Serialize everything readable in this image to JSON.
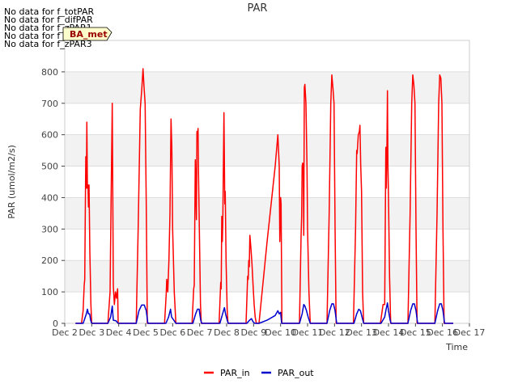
{
  "chart_data": {
    "type": "line",
    "title": "PAR",
    "xlabel": "Time",
    "ylabel": "PAR (umol/m2/s)",
    "ylim": [
      0,
      900
    ],
    "xlim": [
      2,
      17
    ],
    "yticks": [
      0,
      100,
      200,
      300,
      400,
      500,
      600,
      700,
      800
    ],
    "xticks": [
      {
        "x": 2,
        "label": "Dec 2"
      },
      {
        "x": 3,
        "label": "Dec 3"
      },
      {
        "x": 4,
        "label": "Dec 4"
      },
      {
        "x": 5,
        "label": "Dec 5"
      },
      {
        "x": 6,
        "label": "Dec 6"
      },
      {
        "x": 7,
        "label": "Dec 7"
      },
      {
        "x": 8,
        "label": "Dec 8"
      },
      {
        "x": 9,
        "label": "Dec 9"
      },
      {
        "x": 10,
        "label": "Dec 10"
      },
      {
        "x": 11,
        "label": "Dec 11"
      },
      {
        "x": 12,
        "label": "Dec 12"
      },
      {
        "x": 13,
        "label": "Dec 13"
      },
      {
        "x": 14,
        "label": "Dec 14"
      },
      {
        "x": 15,
        "label": "Dec 15"
      },
      {
        "x": 16,
        "label": "Dec 16"
      },
      {
        "x": 17,
        "label": "Dec 17"
      }
    ],
    "no_data_notes": [
      "No data for f_totPAR",
      "No data for f_difPAR",
      "No data for f_zPAR1",
      "No data for f_zPAR2",
      "No data for f_zPAR3"
    ],
    "tooltip": "BA_met",
    "grid": true,
    "legend_position": "bottom-center",
    "series": [
      {
        "name": "PAR_in",
        "color": "#ff0000",
        "points": [
          [
            2.4,
            0
          ],
          [
            2.62,
            0
          ],
          [
            2.68,
            40
          ],
          [
            2.72,
            120
          ],
          [
            2.74,
            140
          ],
          [
            2.76,
            330
          ],
          [
            2.78,
            530
          ],
          [
            2.8,
            430
          ],
          [
            2.82,
            640
          ],
          [
            2.84,
            430
          ],
          [
            2.86,
            440
          ],
          [
            2.88,
            370
          ],
          [
            2.9,
            440
          ],
          [
            2.93,
            230
          ],
          [
            2.97,
            60
          ],
          [
            3.0,
            0
          ],
          [
            3.6,
            0
          ],
          [
            3.68,
            100
          ],
          [
            3.72,
            400
          ],
          [
            3.76,
            700
          ],
          [
            3.8,
            120
          ],
          [
            3.84,
            60
          ],
          [
            3.88,
            100
          ],
          [
            3.92,
            80
          ],
          [
            3.96,
            110
          ],
          [
            3.98,
            0
          ],
          [
            4.65,
            0
          ],
          [
            4.72,
            300
          ],
          [
            4.8,
            680
          ],
          [
            4.86,
            750
          ],
          [
            4.9,
            810
          ],
          [
            4.94,
            750
          ],
          [
            4.98,
            700
          ],
          [
            5.02,
            380
          ],
          [
            5.06,
            0
          ],
          [
            5.7,
            0
          ],
          [
            5.76,
            90
          ],
          [
            5.78,
            140
          ],
          [
            5.82,
            100
          ],
          [
            5.86,
            200
          ],
          [
            5.9,
            350
          ],
          [
            5.94,
            650
          ],
          [
            5.97,
            560
          ],
          [
            6.0,
            300
          ],
          [
            6.06,
            100
          ],
          [
            6.12,
            0
          ],
          [
            6.72,
            0
          ],
          [
            6.78,
            110
          ],
          [
            6.8,
            120
          ],
          [
            6.84,
            520
          ],
          [
            6.86,
            420
          ],
          [
            6.88,
            330
          ],
          [
            6.9,
            610
          ],
          [
            6.92,
            600
          ],
          [
            6.94,
            620
          ],
          [
            6.96,
            470
          ],
          [
            6.99,
            300
          ],
          [
            7.03,
            60
          ],
          [
            7.06,
            0
          ],
          [
            7.72,
            0
          ],
          [
            7.78,
            130
          ],
          [
            7.8,
            110
          ],
          [
            7.82,
            340
          ],
          [
            7.84,
            260
          ],
          [
            7.86,
            330
          ],
          [
            7.88,
            500
          ],
          [
            7.9,
            670
          ],
          [
            7.93,
            380
          ],
          [
            7.95,
            420
          ],
          [
            7.98,
            200
          ],
          [
            8.02,
            40
          ],
          [
            8.05,
            0
          ],
          [
            8.72,
            0
          ],
          [
            8.78,
            150
          ],
          [
            8.8,
            140
          ],
          [
            8.82,
            200
          ],
          [
            8.84,
            180
          ],
          [
            8.86,
            280
          ],
          [
            8.9,
            240
          ],
          [
            8.94,
            190
          ],
          [
            8.98,
            120
          ],
          [
            9.02,
            60
          ],
          [
            9.06,
            20
          ],
          [
            9.1,
            0
          ],
          [
            9.2,
            0
          ],
          [
            9.5,
            260
          ],
          [
            9.8,
            500
          ],
          [
            9.9,
            600
          ],
          [
            9.95,
            500
          ],
          [
            9.97,
            260
          ],
          [
            10.0,
            400
          ],
          [
            10.02,
            380
          ],
          [
            10.05,
            0
          ],
          [
            10.7,
            0
          ],
          [
            10.76,
            280
          ],
          [
            10.78,
            340
          ],
          [
            10.8,
            500
          ],
          [
            10.82,
            510
          ],
          [
            10.84,
            490
          ],
          [
            10.86,
            280
          ],
          [
            10.88,
            750
          ],
          [
            10.9,
            760
          ],
          [
            10.94,
            700
          ],
          [
            10.98,
            500
          ],
          [
            11.0,
            300
          ],
          [
            11.05,
            100
          ],
          [
            11.1,
            0
          ],
          [
            11.72,
            0
          ],
          [
            11.8,
            350
          ],
          [
            11.86,
            700
          ],
          [
            11.9,
            790
          ],
          [
            11.94,
            750
          ],
          [
            11.98,
            700
          ],
          [
            12.02,
            300
          ],
          [
            12.06,
            0
          ],
          [
            12.7,
            0
          ],
          [
            12.78,
            300
          ],
          [
            12.82,
            550
          ],
          [
            12.84,
            540
          ],
          [
            12.88,
            600
          ],
          [
            12.92,
            610
          ],
          [
            12.94,
            630
          ],
          [
            12.97,
            500
          ],
          [
            13.0,
            420
          ],
          [
            13.04,
            100
          ],
          [
            13.08,
            0
          ],
          [
            13.7,
            0
          ],
          [
            13.8,
            60
          ],
          [
            13.86,
            60
          ],
          [
            13.9,
            560
          ],
          [
            13.92,
            430
          ],
          [
            13.94,
            550
          ],
          [
            13.96,
            740
          ],
          [
            13.98,
            500
          ],
          [
            14.0,
            400
          ],
          [
            14.04,
            150
          ],
          [
            14.08,
            0
          ],
          [
            14.72,
            0
          ],
          [
            14.8,
            350
          ],
          [
            14.86,
            700
          ],
          [
            14.9,
            790
          ],
          [
            14.94,
            760
          ],
          [
            14.98,
            700
          ],
          [
            15.02,
            300
          ],
          [
            15.06,
            0
          ],
          [
            15.72,
            0
          ],
          [
            15.8,
            350
          ],
          [
            15.86,
            700
          ],
          [
            15.9,
            790
          ],
          [
            15.94,
            780
          ],
          [
            15.98,
            700
          ],
          [
            16.02,
            300
          ],
          [
            16.06,
            0
          ],
          [
            16.4,
            0
          ]
        ]
      },
      {
        "name": "PAR_out",
        "color": "#0000cc",
        "points": [
          [
            2.4,
            0
          ],
          [
            2.68,
            0
          ],
          [
            2.74,
            15
          ],
          [
            2.8,
            30
          ],
          [
            2.84,
            45
          ],
          [
            2.88,
            30
          ],
          [
            2.92,
            30
          ],
          [
            2.96,
            10
          ],
          [
            3.0,
            0
          ],
          [
            3.6,
            0
          ],
          [
            3.7,
            20
          ],
          [
            3.76,
            55
          ],
          [
            3.8,
            10
          ],
          [
            3.9,
            8
          ],
          [
            3.98,
            0
          ],
          [
            4.65,
            0
          ],
          [
            4.75,
            40
          ],
          [
            4.85,
            58
          ],
          [
            4.95,
            58
          ],
          [
            5.02,
            40
          ],
          [
            5.08,
            0
          ],
          [
            5.75,
            0
          ],
          [
            5.85,
            20
          ],
          [
            5.92,
            45
          ],
          [
            5.96,
            20
          ],
          [
            6.04,
            10
          ],
          [
            6.12,
            0
          ],
          [
            6.75,
            0
          ],
          [
            6.85,
            30
          ],
          [
            6.92,
            45
          ],
          [
            6.98,
            45
          ],
          [
            7.04,
            10
          ],
          [
            7.08,
            0
          ],
          [
            7.75,
            0
          ],
          [
            7.85,
            30
          ],
          [
            7.92,
            50
          ],
          [
            7.96,
            30
          ],
          [
            8.02,
            10
          ],
          [
            8.06,
            0
          ],
          [
            8.75,
            0
          ],
          [
            8.85,
            10
          ],
          [
            8.92,
            15
          ],
          [
            8.98,
            5
          ],
          [
            9.04,
            0
          ],
          [
            9.2,
            0
          ],
          [
            9.5,
            10
          ],
          [
            9.8,
            25
          ],
          [
            9.9,
            40
          ],
          [
            9.95,
            30
          ],
          [
            10.0,
            35
          ],
          [
            10.04,
            0
          ],
          [
            10.7,
            0
          ],
          [
            10.8,
            30
          ],
          [
            10.86,
            60
          ],
          [
            10.9,
            55
          ],
          [
            10.96,
            40
          ],
          [
            11.02,
            20
          ],
          [
            11.1,
            0
          ],
          [
            11.72,
            0
          ],
          [
            11.82,
            40
          ],
          [
            11.9,
            62
          ],
          [
            11.96,
            62
          ],
          [
            12.02,
            40
          ],
          [
            12.08,
            0
          ],
          [
            12.72,
            0
          ],
          [
            12.82,
            30
          ],
          [
            12.9,
            45
          ],
          [
            12.96,
            40
          ],
          [
            13.02,
            20
          ],
          [
            13.08,
            0
          ],
          [
            13.72,
            0
          ],
          [
            13.86,
            20
          ],
          [
            13.9,
            40
          ],
          [
            13.96,
            65
          ],
          [
            14.0,
            40
          ],
          [
            14.06,
            10
          ],
          [
            14.1,
            0
          ],
          [
            14.72,
            0
          ],
          [
            14.82,
            40
          ],
          [
            14.9,
            62
          ],
          [
            14.96,
            62
          ],
          [
            15.02,
            40
          ],
          [
            15.08,
            0
          ],
          [
            15.72,
            0
          ],
          [
            15.82,
            40
          ],
          [
            15.9,
            62
          ],
          [
            15.96,
            62
          ],
          [
            16.02,
            40
          ],
          [
            16.08,
            0
          ],
          [
            16.4,
            0
          ]
        ]
      }
    ]
  }
}
